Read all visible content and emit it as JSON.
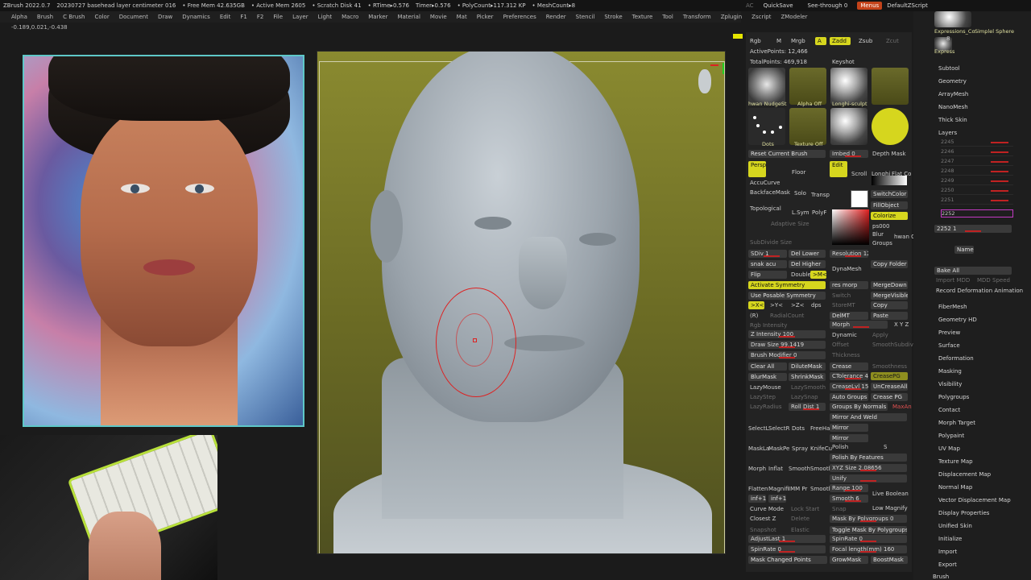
{
  "titlebar": {
    "app": "ZBrush 2022.0.7",
    "project": "20230727 basehead layer centimeter 016",
    "free_mem": "• Free Mem 42.635GB",
    "active_mem": "• Active Mem 2605",
    "scratch": "• Scratch Disk 41",
    "rtime": "• RTime▸0.576",
    "timer": "Timer▸0.576",
    "polycount": "• PolyCount▸117.312 KP",
    "meshcount": "• MeshCount▸8",
    "ac": "AC",
    "quicksave": "QuickSave",
    "seethrough": "See-through 0",
    "menus": "Menus",
    "script": "DefaultZScript"
  },
  "menubar": [
    "Alpha",
    "Brush",
    "C Brush",
    "Color",
    "Document",
    "Draw",
    "Dynamics",
    "Edit",
    "F1",
    "F2",
    "File",
    "Layer",
    "Light",
    "Macro",
    "Marker",
    "Material",
    "Movie",
    "Mat",
    "Picker",
    "Preferences",
    "Render",
    "Stencil",
    "Stroke",
    "Texture",
    "Tool",
    "Transform",
    "Zplugin",
    "Zscript",
    "ZModeler"
  ],
  "coords": "-0.189,0.021,-0.438",
  "panel": {
    "rgb": "Rgb",
    "m": "M",
    "mrgb": "Mrgb",
    "a": "A",
    "zadd": "Zadd",
    "zsub": "Zsub",
    "zcut": "Zcut",
    "active_points": "ActivePoints: 12,466",
    "total_points": "TotalPoints: 469,918",
    "keyshot": "Keyshot",
    "thumb_labels": [
      "hwan NudgeSt",
      "Alpha Off",
      "Longhi-sculpt",
      "Dots",
      "Texture Off"
    ],
    "reset_brush": "Reset Current Brush",
    "imbed": "Imbed 0",
    "depth_mask": "Depth Mask",
    "persp": "Persp",
    "floor": "Floor",
    "edit": "Edit",
    "scroll": "Scroll",
    "longhi": "Longhi",
    "flat_co": "Flat Co",
    "accucurve": "AccuCurve",
    "solo": "Solo",
    "transp": "Transp",
    "backfacemask": "BackfaceMask",
    "switchcolor": "SwitchColor",
    "topological": "Topological",
    "lsym": "L.Sym",
    "polyf": "PolyF",
    "fillobject": "FillObject",
    "adaptive": "Adaptive Size",
    "colorize": "Colorize",
    "ps000": "ps000",
    "blur": "Blur",
    "groups": "Groups",
    "hwan_c": "hwan C",
    "subdivide": "SubDivide Size",
    "sdiv": "SDiv 1",
    "del_lower": "Del Lower",
    "resolution": "Resolution 128",
    "snak": "snak acu",
    "del_higher": "Del Higher",
    "dynamesh": "DynaMesh",
    "copy_folder": "Copy Folder",
    "flip": "Flip",
    "double": "Double",
    "mc": ">M<",
    "activate_sym": "Activate Symmetry",
    "res_morp": "res morp",
    "mergedown": "MergeDown",
    "use_posable": "Use Posable Symmetry",
    "switch": "Switch",
    "mergevisible": "MergeVisible",
    "x": ">X<",
    "y": ">Y<",
    "z": ">Z<",
    "dps": "dps",
    "storemt": "StoreMT",
    "copy": "Copy",
    "r": "(R)",
    "radialcount": "RadialCount",
    "delmt": "DelMT",
    "paste": "Paste",
    "rgb_int": "Rgb Intensity",
    "morph": "Morph",
    "xyz": "X Y Z",
    "zint": "Z Intensity 100",
    "dynamic": "Dynamic",
    "apply": "Apply",
    "drawsize": "Draw Size 99.1419",
    "dynamic2": "Dynamic",
    "offset": "Offset",
    "smoothsub": "SmoothSubdiv",
    "brush_mod": "Brush Modifier 0",
    "thickness": "Thickness",
    "clearall": "Clear All",
    "dilutemask": "DiluteMask",
    "crease": "Crease",
    "smoothness": "Smoothness",
    "blurmask": "BlurMask",
    "shrinkmask": "ShrinkMask",
    "ctolerance": "CTolerance 45",
    "creasepg": "CreasePG",
    "lazymouse": "LazyMouse",
    "lazysmooth": "LazySmooth",
    "creaselvl": "CreaseLvl 15",
    "uncreaseall": "UnCreaseAll",
    "lazystep": "LazyStep",
    "lazysnap": "LazySnap",
    "autogroups": "Auto Groups",
    "creasepg2": "Crease PG",
    "lazyradius": "LazyRadius",
    "rolldist": "Roll Dist 1",
    "groupsbynormals": "Groups By Normals",
    "maxan": "MaxAn",
    "mirrorweld": "Mirror And Weld",
    "brush_names": [
      "SelectL",
      "SelectR",
      "Dots",
      "FreeHa",
      "MaskLa",
      "MaskPe",
      "Spray",
      "KnifeCu",
      "Morph",
      "Inflat",
      "Smooth",
      "Smooth",
      "Flatten",
      "Magnifi",
      "IMM Pr",
      "Smooth"
    ],
    "mirror": "Mirror",
    "polish": "Polish",
    "s": "S",
    "polishbyfeatures": "Polish By Features",
    "xyzsize": "XYZ Size 2.08656",
    "unify": "Unify",
    "range": "Range 100",
    "liveboolean": "Live Boolean",
    "inf1": "inf+1",
    "inf2": "inf+1",
    "smooth6": "Smooth 6",
    "curvemode": "Curve Mode",
    "lockstart": "Lock Start",
    "snap": "Snap",
    "lowmag": "Low Magnify",
    "closestz": "Closest Z",
    "delete": "Delete",
    "maskbypoly": "Mask By Polygroups 0",
    "snapshot": "Snapshot",
    "elastic": "Elastic",
    "togglemask": "Toggle Mask By Polygroups",
    "adjustlast": "AdjustLast 1",
    "spinrate": "SpinRate 0",
    "spinrate2": "SpinRate 0",
    "focal": "Focal length(mm) 160",
    "maskchanged": "Mask Changed Points",
    "growmask": "GrowMask",
    "boostmask": "BoostMask"
  },
  "right": {
    "tool_thumbs": [
      "Expressions_Co",
      "Simplel Sphere",
      "Express"
    ],
    "count": "8",
    "items_top": [
      "Subtool",
      "Geometry",
      "ArrayMesh",
      "NanoMesh",
      "Thick Skin",
      "Layers"
    ],
    "layers": [
      "2245",
      "2246",
      "2247",
      "2248",
      "2249",
      "2250",
      "2251",
      "2252"
    ],
    "layer_value": "2252 1",
    "name": "Name",
    "bake_all": "Bake All",
    "import_mdd": "Import MDD",
    "mdd_speed": "MDD Speed",
    "record": "Record Deformation Animation",
    "items_bottom": [
      "FiberMesh",
      "Geometry HD",
      "Preview",
      "Surface",
      "Deformation",
      "Masking",
      "Visibility",
      "Polygroups",
      "Contact",
      "Morph Target",
      "Polypaint",
      "UV Map",
      "Texture Map",
      "Displacement Map",
      "Normal Map",
      "Vector Displacement Map",
      "Display Properties",
      "Unified Skin",
      "Initialize",
      "Import",
      "Export"
    ],
    "brush": "Brush"
  },
  "colors": {
    "accent": "#d6d61e",
    "frame": "#5ec8c8",
    "brush": "#dd2222",
    "viewport_bg": "#7a7a2a"
  }
}
